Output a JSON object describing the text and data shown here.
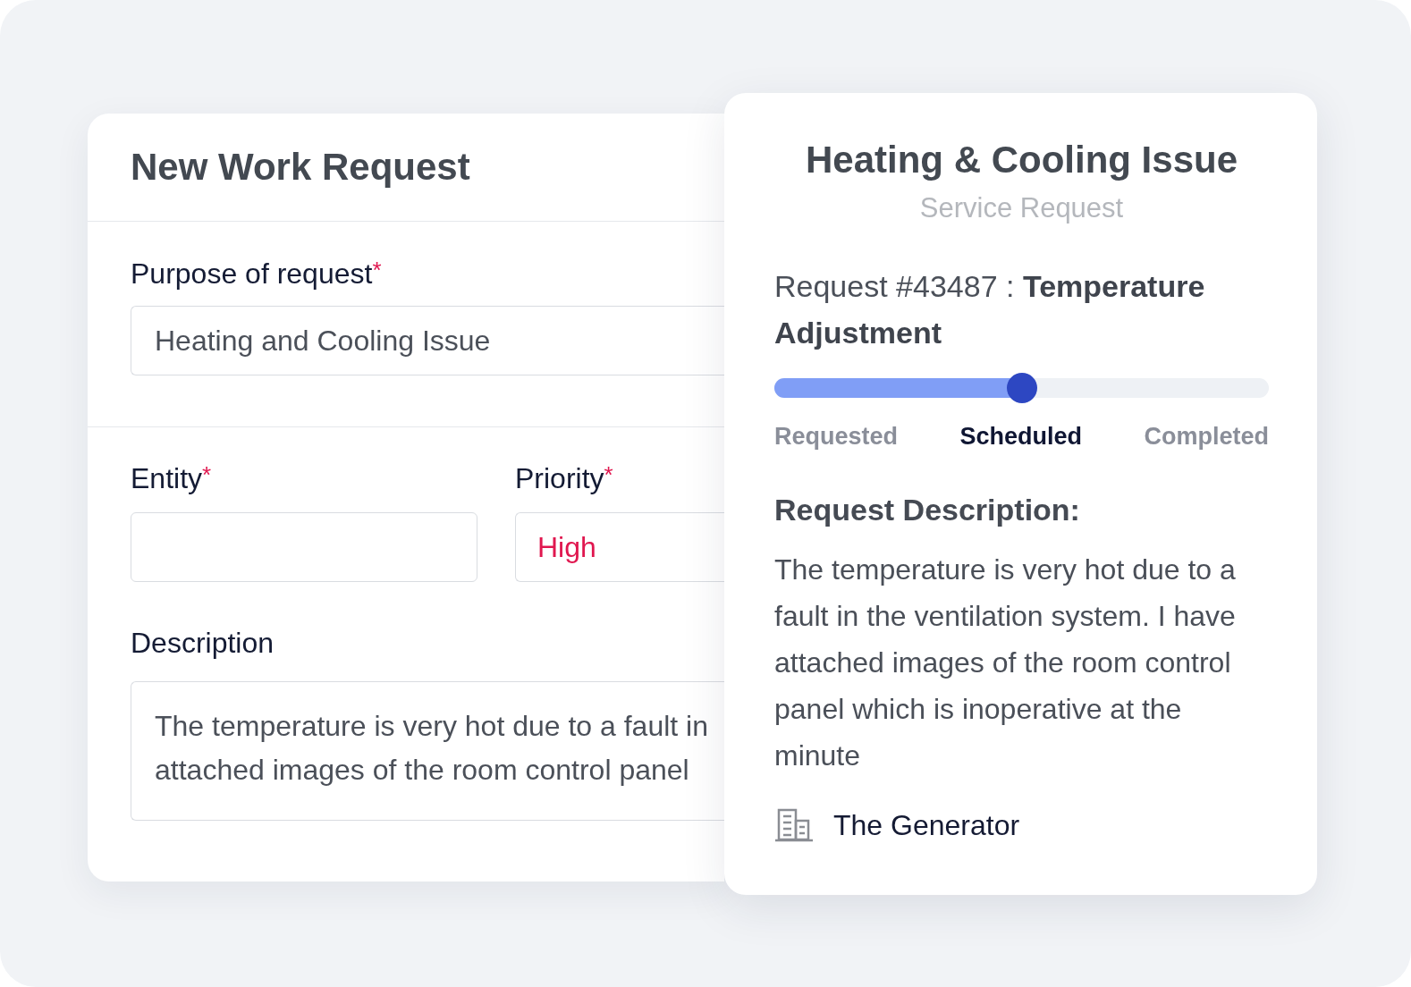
{
  "work_request_form": {
    "title": "New Work Request",
    "purpose": {
      "label": "Purpose of request",
      "required_mark": "*",
      "value": "Heating and Cooling Issue"
    },
    "entity": {
      "label": "Entity",
      "required_mark": "*"
    },
    "priority": {
      "label": "Priority",
      "required_mark": "*",
      "value": "High"
    },
    "description": {
      "label": "Description",
      "value_lines": [
        "The temperature is very hot due to a fault in",
        "attached images of the room control panel"
      ]
    }
  },
  "request_card": {
    "title": "Heating & Cooling Issue",
    "subtitle": "Service Request",
    "heading": "Request #43487 : **Temperature Adjustment**",
    "progress": {
      "level": 0.5,
      "steps": [
        {
          "label": "Requested",
          "selected": false
        },
        {
          "label": "Scheduled",
          "selected": true
        },
        {
          "label": "Completed",
          "selected": false
        }
      ]
    },
    "description_heading": "Request Description:",
    "description": "The temperature is very hot due to a fault in the ventilation system. I have attached images of the room control panel which is inoperative at the minute",
    "location": "The Generator"
  }
}
